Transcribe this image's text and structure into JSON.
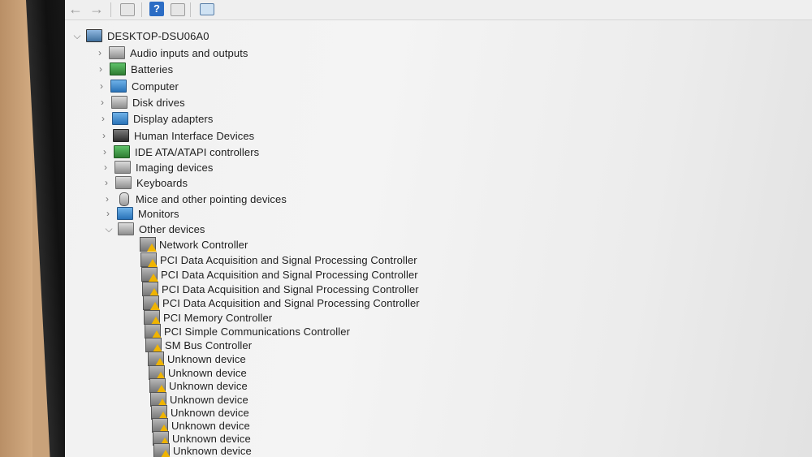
{
  "root": {
    "label": "DESKTOP-DSU06A0"
  },
  "categories": [
    {
      "label": "Audio inputs and outputs",
      "icon": "speaker-icon"
    },
    {
      "label": "Batteries",
      "icon": "battery-icon"
    },
    {
      "label": "Computer",
      "icon": "computer-icon"
    },
    {
      "label": "Disk drives",
      "icon": "disk-drive-icon"
    },
    {
      "label": "Display adapters",
      "icon": "display-adapter-icon"
    },
    {
      "label": "Human Interface Devices",
      "icon": "hid-icon"
    },
    {
      "label": "IDE ATA/ATAPI controllers",
      "icon": "ide-controller-icon"
    },
    {
      "label": "Imaging devices",
      "icon": "camera-icon"
    },
    {
      "label": "Keyboards",
      "icon": "keyboard-icon"
    },
    {
      "label": "Mice and other pointing devices",
      "icon": "mouse-icon"
    },
    {
      "label": "Monitors",
      "icon": "monitor-icon"
    },
    {
      "label": "Other devices",
      "icon": "other-devices-icon",
      "expanded": true
    }
  ],
  "other_devices": [
    "Network Controller",
    "PCI Data Acquisition and Signal Processing Controller",
    "PCI Data Acquisition and Signal Processing Controller",
    "PCI Data Acquisition and Signal Processing Controller",
    "PCI Data Acquisition and Signal Processing Controller",
    "PCI Memory Controller",
    "PCI Simple Communications Controller",
    "SM Bus Controller",
    "Unknown device",
    "Unknown device",
    "Unknown device",
    "Unknown device",
    "Unknown device",
    "Unknown device",
    "Unknown device",
    "Unknown device"
  ],
  "toolbar": [
    "back-icon",
    "forward-icon",
    "properties-icon",
    "help-icon",
    "show-hide-icon",
    "scan-hardware-icon"
  ]
}
